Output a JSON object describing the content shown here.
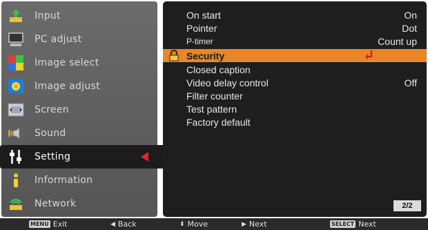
{
  "sidebar": {
    "items": [
      {
        "label": "Input",
        "icon": "input-icon"
      },
      {
        "label": "PC adjust",
        "icon": "pc-adjust-icon"
      },
      {
        "label": "Image select",
        "icon": "image-select-icon"
      },
      {
        "label": "Image adjust",
        "icon": "image-adjust-icon"
      },
      {
        "label": "Screen",
        "icon": "screen-icon"
      },
      {
        "label": "Sound",
        "icon": "sound-icon"
      },
      {
        "label": "Setting",
        "icon": "setting-icon",
        "selected": true
      },
      {
        "label": "Information",
        "icon": "information-icon"
      },
      {
        "label": "Network",
        "icon": "network-icon"
      }
    ]
  },
  "settings": {
    "rows": [
      {
        "label": "On start",
        "value": "On"
      },
      {
        "label": "Pointer",
        "value": "Dot"
      },
      {
        "label": "P-timer",
        "value": "Count up"
      },
      {
        "label": "Security",
        "value": "",
        "selected": true
      },
      {
        "label": "Closed caption",
        "value": ""
      },
      {
        "label": "Video delay control",
        "value": "Off"
      },
      {
        "label": "Filter counter",
        "value": ""
      },
      {
        "label": "Test pattern",
        "value": ""
      },
      {
        "label": "Factory default",
        "value": ""
      }
    ],
    "page_indicator": "2/2"
  },
  "footer": {
    "exit_key": "MENU",
    "exit_label": "Exit",
    "back_label": "Back",
    "move_label": "Move",
    "next_label": "Next",
    "select_key": "SELECT",
    "select_next_label": "Next"
  },
  "colors": {
    "highlight": "#e8862a",
    "selected_arrow": "#e0262b",
    "panel_bg": "#1e1e1e",
    "menu_bg": "#606060"
  }
}
